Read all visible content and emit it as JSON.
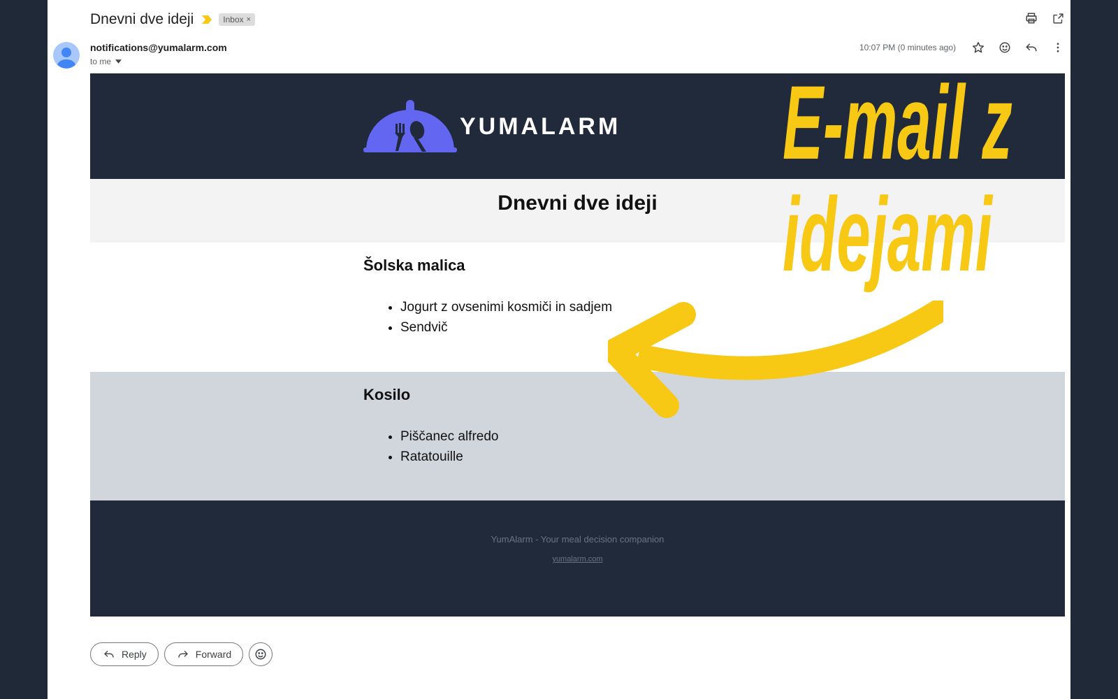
{
  "subject": "Dnevni dve ideji",
  "inbox_chip": "Inbox",
  "chip_close": "×",
  "sender": "notifications@yumalarm.com",
  "to_me": "to me",
  "timestamp": "10:07 PM (0 minutes ago)",
  "email": {
    "brand": "YUMALARM",
    "title": "Dnevni dve ideji",
    "sections": [
      {
        "heading": "Šolska malica",
        "items": [
          "Jogurt z ovsenimi kosmiči in sadjem",
          "Sendvič"
        ]
      },
      {
        "heading": "Kosilo",
        "items": [
          "Piščanec alfredo",
          "Ratatouille"
        ]
      }
    ],
    "footer": {
      "tagline": "YumAlarm - Your meal decision companion",
      "link": "yumalarm.com"
    }
  },
  "actions": {
    "reply": "Reply",
    "forward": "Forward"
  },
  "overlay": {
    "line1": "E-mail z",
    "line2": "idejami"
  },
  "colors": {
    "accent": "#f7c814",
    "header_bg": "#212a3b",
    "logo": "#6366f1",
    "section_alt": "#d1d5dc"
  },
  "icons": [
    "important-marker-icon",
    "print-icon",
    "open-new-window-icon",
    "avatar-person-icon",
    "chevron-down-icon",
    "star-icon",
    "emoji-icon",
    "reply-icon",
    "more-vertical-icon",
    "cloche-logo-icon",
    "forward-icon",
    "curved-arrow-icon"
  ]
}
